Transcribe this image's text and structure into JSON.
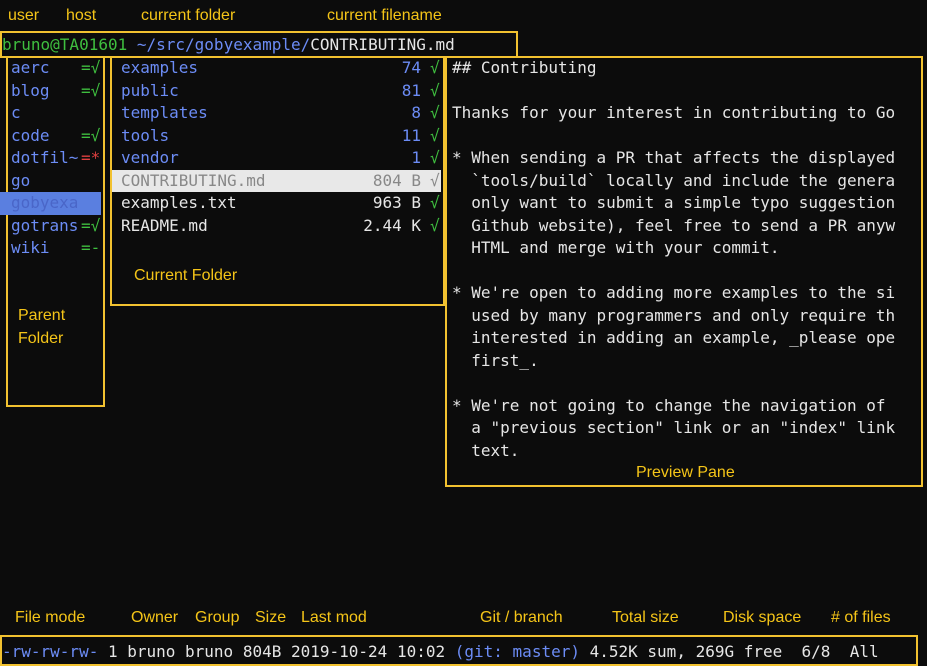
{
  "annotations": {
    "top": [
      "user",
      "host",
      "current folder",
      "current filename"
    ],
    "parent_folder": [
      "Parent",
      "Folder"
    ],
    "current_folder": "Current Folder",
    "preview_pane": "Preview Pane",
    "bottom": [
      "File mode",
      "Owner",
      "Group",
      "Size",
      "Last mod",
      "Git / branch",
      "Total size",
      "Disk space",
      "# of files"
    ]
  },
  "prompt": {
    "user_host": "bruno@TA01601",
    "path": " ~/src/gobyexample/",
    "filename": "CONTRIBUTING.md"
  },
  "parent": [
    {
      "name": "aerc",
      "mark": "=√",
      "mark_color": "green"
    },
    {
      "name": "blog",
      "mark": "=√",
      "mark_color": "green"
    },
    {
      "name": "c",
      "mark": "",
      "mark_color": "green"
    },
    {
      "name": "code",
      "mark": "=√",
      "mark_color": "green"
    },
    {
      "name": "dotfil~",
      "mark": "=*",
      "mark_color": "red"
    },
    {
      "name": "go",
      "mark": "",
      "mark_color": "green"
    },
    {
      "name": "gobyexa",
      "mark": "",
      "mark_color": "green",
      "selected": true
    },
    {
      "name": "gotrans",
      "mark": "=√",
      "mark_color": "green"
    },
    {
      "name": "wiki",
      "mark": "=-",
      "mark_color": "green"
    }
  ],
  "current": [
    {
      "name": "examples",
      "size": "74",
      "mark": "√",
      "dir": true
    },
    {
      "name": "public",
      "size": "81",
      "mark": "√",
      "dir": true
    },
    {
      "name": "templates",
      "size": "8",
      "mark": "√",
      "dir": true
    },
    {
      "name": "tools",
      "size": "11",
      "mark": "√",
      "dir": true
    },
    {
      "name": "vendor",
      "size": "1",
      "mark": "√",
      "dir": true
    },
    {
      "name": "CONTRIBUTING.md",
      "size": "804 B",
      "mark": "√",
      "dir": false,
      "selected": true
    },
    {
      "name": "examples.txt",
      "size": "963 B",
      "mark": "√",
      "dir": false
    },
    {
      "name": "README.md",
      "size": "2.44 K",
      "mark": "√",
      "dir": false
    }
  ],
  "preview": [
    "## Contributing",
    "",
    "Thanks for your interest in contributing to Go",
    "",
    "* When sending a PR that affects the displayed",
    "  `tools/build` locally and include the genera",
    "  only want to submit a simple typo suggestion",
    "  Github website), feel free to send a PR anyw",
    "  HTML and merge with your commit.",
    "",
    "* We're open to adding more examples to the si",
    "  used by many programmers and only require th",
    "  interested in adding an example, _please ope",
    "  first_.",
    "",
    "* We're not going to change the navigation of",
    "  a \"previous section\" link or an \"index\" link",
    "  text."
  ],
  "status": {
    "mode": "-rw-rw-rw-",
    "rest": " 1 bruno bruno 804B 2019-10-24 10:02 ",
    "git": "(git: master)",
    "totals": " 4.52K sum, 269G free  6/8  All"
  }
}
